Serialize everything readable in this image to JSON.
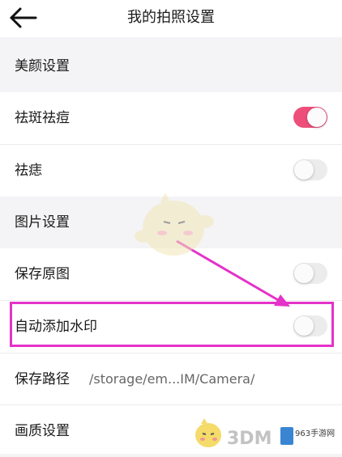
{
  "header": {
    "title": "我的拍照设置"
  },
  "sections": {
    "beauty": {
      "label": "美颜设置",
      "items": [
        {
          "label": "祛斑祛痘",
          "enabled": true
        },
        {
          "label": "祛痣",
          "enabled": false
        }
      ]
    },
    "picture": {
      "label": "图片设置",
      "items": [
        {
          "label": "保存原图",
          "enabled": false
        },
        {
          "label": "自动添加水印",
          "enabled": false
        },
        {
          "label": "保存路径",
          "value": "/storage/em...IM/Camera/"
        },
        {
          "label": "画质设置"
        }
      ]
    }
  },
  "watermark": {
    "text": "3DM",
    "logo_text": "963手游网"
  },
  "colors": {
    "toggle_on": "#ee4f7a",
    "toggle_off": "#ececec",
    "highlight": "#e532c8"
  }
}
